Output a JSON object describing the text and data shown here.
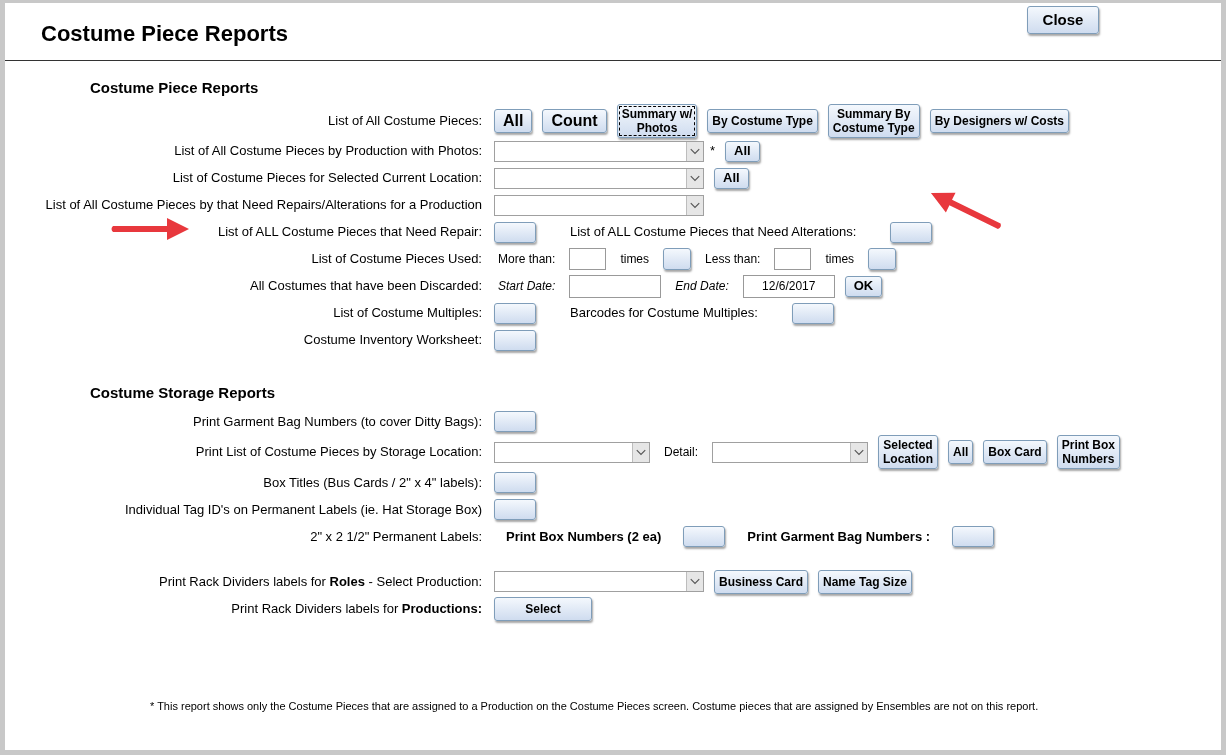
{
  "window": {
    "title": "Costume Piece Reports",
    "close_button": "Close"
  },
  "sections": [
    {
      "heading": "Costume Piece Reports",
      "rows": [
        {
          "label": "List of All Costume Pieces:",
          "controls": [
            {
              "kind": "bigbutton",
              "text": "All",
              "focused": false
            },
            {
              "kind": "bigbutton",
              "text": "Count",
              "focused": false
            },
            {
              "kind": "button",
              "lines": [
                "Summary w/",
                "Photos"
              ],
              "focused": true
            },
            {
              "kind": "button",
              "text": "By Costume Type",
              "focused": false
            },
            {
              "kind": "button",
              "lines": [
                "Summary By",
                "Costume Type"
              ],
              "focused": false
            },
            {
              "kind": "button",
              "text": "By Designers w/ Costs",
              "focused": false
            }
          ]
        },
        {
          "label": "List of All Costume Pieces by Production with Photos:",
          "controls": [
            {
              "kind": "dropdown"
            },
            {
              "kind": "mark",
              "text": "*"
            },
            {
              "kind": "boldbutton",
              "text": "All",
              "focused": false
            }
          ]
        },
        {
          "label": "List of Costume Pieces for Selected Current Location:",
          "controls": [
            {
              "kind": "dropdown"
            },
            {
              "kind": "boldbutton",
              "text": "All",
              "focused": false
            }
          ]
        },
        {
          "label": "List of All Costume Pieces by that Need Repairs/Alterations for a  Production",
          "controls": [
            {
              "kind": "dropdown"
            }
          ]
        },
        {
          "label": "List of ALL Costume Pieces that Need Repair:",
          "controls": [
            {
              "kind": "blank",
              "focused": false
            },
            {
              "kind": "caption",
              "text": "List of ALL Costume Pieces that Need Alterations:"
            },
            {
              "kind": "blank",
              "focused": false
            }
          ]
        },
        {
          "label": "List of Costume Pieces Used:",
          "controls": [
            {
              "kind": "hint",
              "text": "More than:"
            },
            {
              "kind": "countbox"
            },
            {
              "kind": "hint",
              "text": "times"
            },
            {
              "kind": "square",
              "focused": false
            },
            {
              "kind": "hint",
              "text": "Less than:"
            },
            {
              "kind": "countbox"
            },
            {
              "kind": "hint",
              "text": "times"
            },
            {
              "kind": "square",
              "focused": false
            }
          ]
        },
        {
          "label": "All Costumes that have been Discarded:",
          "controls": [
            {
              "kind": "datelabel",
              "text": "Start Date:"
            },
            {
              "kind": "datebox"
            },
            {
              "kind": "datelabel",
              "text": "End Date:"
            },
            {
              "kind": "datebox",
              "value": "12/6/2017"
            },
            {
              "kind": "boldbutton",
              "text": "OK",
              "focused": false
            }
          ]
        },
        {
          "label": "List of Costume Multiples:",
          "controls": [
            {
              "kind": "blank",
              "focused": false
            },
            {
              "kind": "caption",
              "text": "Barcodes for Costume Multiples:"
            },
            {
              "kind": "blank",
              "focused": false
            }
          ]
        },
        {
          "label": "Costume Inventory Worksheet:",
          "controls": [
            {
              "kind": "blank",
              "focused": false
            }
          ]
        }
      ]
    },
    {
      "heading": "Costume Storage Reports",
      "rows": [
        {
          "label": "Print Garment Bag Numbers (to cover Ditty Bags):",
          "controls": [
            {
              "kind": "blank",
              "focused": false
            }
          ]
        },
        {
          "label": "Print List of Costume Pieces by Storage Location:",
          "controls": [
            {
              "kind": "dropdown"
            },
            {
              "kind": "hint",
              "text": "Detail:"
            },
            {
              "kind": "dropdown"
            },
            {
              "kind": "button",
              "lines": [
                "Selected",
                "Location"
              ],
              "focused": false
            },
            {
              "kind": "button",
              "text": "All",
              "focused": false
            },
            {
              "kind": "button",
              "text": "Box Card",
              "focused": false
            },
            {
              "kind": "button",
              "lines": [
                "Print Box",
                "Numbers"
              ],
              "focused": false
            }
          ]
        },
        {
          "label": "Box Titles (Bus Cards / 2\" x 4\" labels):",
          "controls": [
            {
              "kind": "blank",
              "focused": false
            }
          ]
        },
        {
          "label": "Individual Tag ID's on Permanent Labels (ie. Hat Storage Box)",
          "controls": [
            {
              "kind": "blank",
              "focused": false
            }
          ]
        },
        {
          "label": "2\" x 2 1/2\" Permanent Labels:",
          "controls": [
            {
              "kind": "boldlabel",
              "text": "Print Box Numbers (2 ea)"
            },
            {
              "kind": "blank",
              "focused": false
            },
            {
              "kind": "boldlabel",
              "text": "Print Garment Bag Numbers :"
            },
            {
              "kind": "blank",
              "focused": false
            }
          ]
        },
        {
          "label": "Print Rack Dividers labels for  **Roles** -  Select Production:",
          "controls": [
            {
              "kind": "dropdown"
            },
            {
              "kind": "button",
              "text": "Business Card",
              "focused": false
            },
            {
              "kind": "button",
              "text": "Name Tag Size",
              "focused": false
            }
          ]
        },
        {
          "label": "Print Rack Dividers labels for  **Productions:**",
          "controls": [
            {
              "kind": "widebutton",
              "text": "Select",
              "focused": false
            }
          ]
        }
      ]
    }
  ],
  "footnote": "*  This report shows only the Costume Pieces that are assigned to a Production on the Costume Pieces screen.  Costume pieces that are assigned by Ensembles are not on this report."
}
